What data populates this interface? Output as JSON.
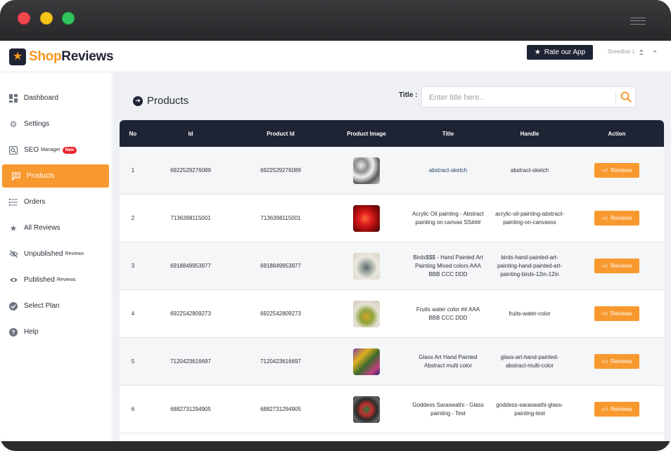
{
  "app": {
    "logo_shop": "Shop",
    "logo_reviews": "Reviews",
    "rate_button": "Rate our App",
    "user_name": "Sreedhar L"
  },
  "sidebar": {
    "items": [
      {
        "label": "Dashboard",
        "icon": "dashboard-icon"
      },
      {
        "label": "Settings",
        "icon": "gear-icon"
      },
      {
        "label": "SEO",
        "suffix": "Manager",
        "badge": "New",
        "icon": "seo-icon"
      },
      {
        "label": "Products",
        "icon": "chat-icon",
        "active": true
      },
      {
        "label": "Orders",
        "icon": "list-icon"
      },
      {
        "label": "All Reviews",
        "icon": "star-icon"
      },
      {
        "label": "Unpublished",
        "suffix": "Reviews",
        "icon": "eye-off-icon"
      },
      {
        "label": "Published",
        "suffix": "Reviews",
        "icon": "eye-icon"
      },
      {
        "label": "Select Plan",
        "icon": "check-circle-icon"
      },
      {
        "label": "Help",
        "icon": "help-icon"
      }
    ]
  },
  "main": {
    "page_title": "Products",
    "filter_label": "Title :",
    "search_placeholder": "Enter title here..",
    "columns": [
      "No",
      "Id",
      "Product Id",
      "Product Image",
      "Title",
      "Handle",
      "Action"
    ],
    "action_label": "Reviews",
    "rows": [
      {
        "no": "1",
        "id": "6922529276089",
        "product_id": "6922529276089",
        "title": "abstract-sketch",
        "handle": "abstract-sketch",
        "title_link": true
      },
      {
        "no": "2",
        "id": "7136398115001",
        "product_id": "7136398115001",
        "title": "Acrylic Oil painting - Abstract painting on canvas SS###",
        "handle": "acrylic-oil-painting-abstract-painting-on-canvasss"
      },
      {
        "no": "3",
        "id": "6918849953977",
        "product_id": "6918849953977",
        "title": "Birds$$$ - Hand Painted Art Painting Mixed colors AAA BBB CCC DDD",
        "handle": "birds-hand-painted-art-painting-hand-painted-art-painting-birds-12in-12in"
      },
      {
        "no": "4",
        "id": "6922542809273",
        "product_id": "6922542809273",
        "title": "Fruits water color ## AAA BBB CCC DDD",
        "handle": "fruits-water-color"
      },
      {
        "no": "5",
        "id": "7120423616697",
        "product_id": "7120423616697",
        "title": "Glass Art Hand Painted Abstract multi color",
        "handle": "glass-art-hand-painted-abstract-multi-color"
      },
      {
        "no": "6",
        "id": "6882731294905",
        "product_id": "6882731294905",
        "title": "Goddess Saraswathi - Glass painting - Test",
        "handle": "goddess-saraswathi-glass-painting-test"
      }
    ]
  },
  "colors": {
    "accent": "#f8992f",
    "navy": "#1f2434"
  }
}
